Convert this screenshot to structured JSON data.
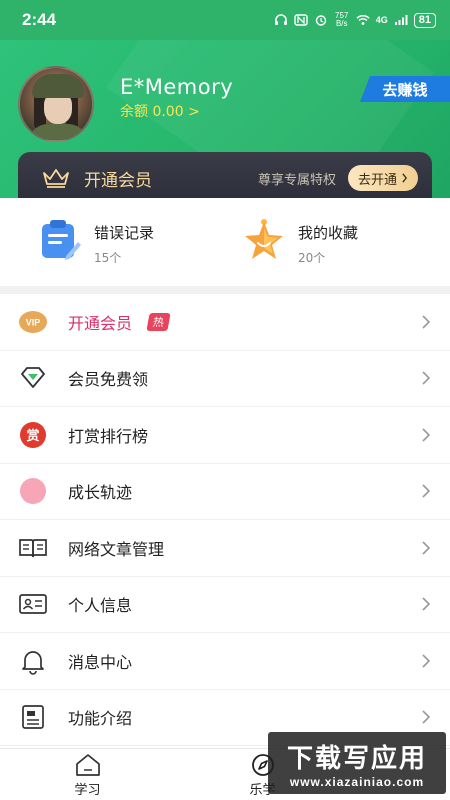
{
  "status_bar": {
    "time": "2:44",
    "net_speed_top": "757",
    "net_speed_bottom": "B/s",
    "signal_label": "4G",
    "battery": "81"
  },
  "profile": {
    "username": "E*Memory",
    "balance": "余额 0.00 >",
    "earn_button": "去赚钱"
  },
  "vip_card": {
    "title": "开通会员",
    "subtitle": "尊享专属特权",
    "button": "去开通"
  },
  "quick": [
    {
      "title": "错误记录",
      "count": "15个",
      "icon": "clipboard-icon"
    },
    {
      "title": "我的收藏",
      "count": "20个",
      "icon": "star-icon"
    }
  ],
  "menu": [
    {
      "label": "开通会员",
      "icon": "vip-icon",
      "hot": true,
      "badge": "热"
    },
    {
      "label": "会员免费领",
      "icon": "diamond-icon"
    },
    {
      "label": "打赏排行榜",
      "icon": "reward-icon",
      "icon_text": "赏"
    },
    {
      "label": "成长轨迹",
      "icon": "growth-icon"
    },
    {
      "label": "网络文章管理",
      "icon": "book-icon"
    },
    {
      "label": "个人信息",
      "icon": "id-card-icon"
    },
    {
      "label": "消息中心",
      "icon": "bell-icon"
    },
    {
      "label": "功能介绍",
      "icon": "document-icon"
    }
  ],
  "tabs": [
    {
      "label": "学习",
      "icon": "home-icon"
    },
    {
      "label": "乐学",
      "icon": "compass-icon"
    }
  ],
  "watermark": {
    "line1": "下载写应用",
    "line2": "www.xiazainiao.com"
  },
  "colors": {
    "header_green": "#2ec27a",
    "earn_blue": "#1e7be0",
    "vip_dark": "#2c2d38",
    "vip_gold": "#f7d99b",
    "hot_pink": "#d9306a"
  }
}
